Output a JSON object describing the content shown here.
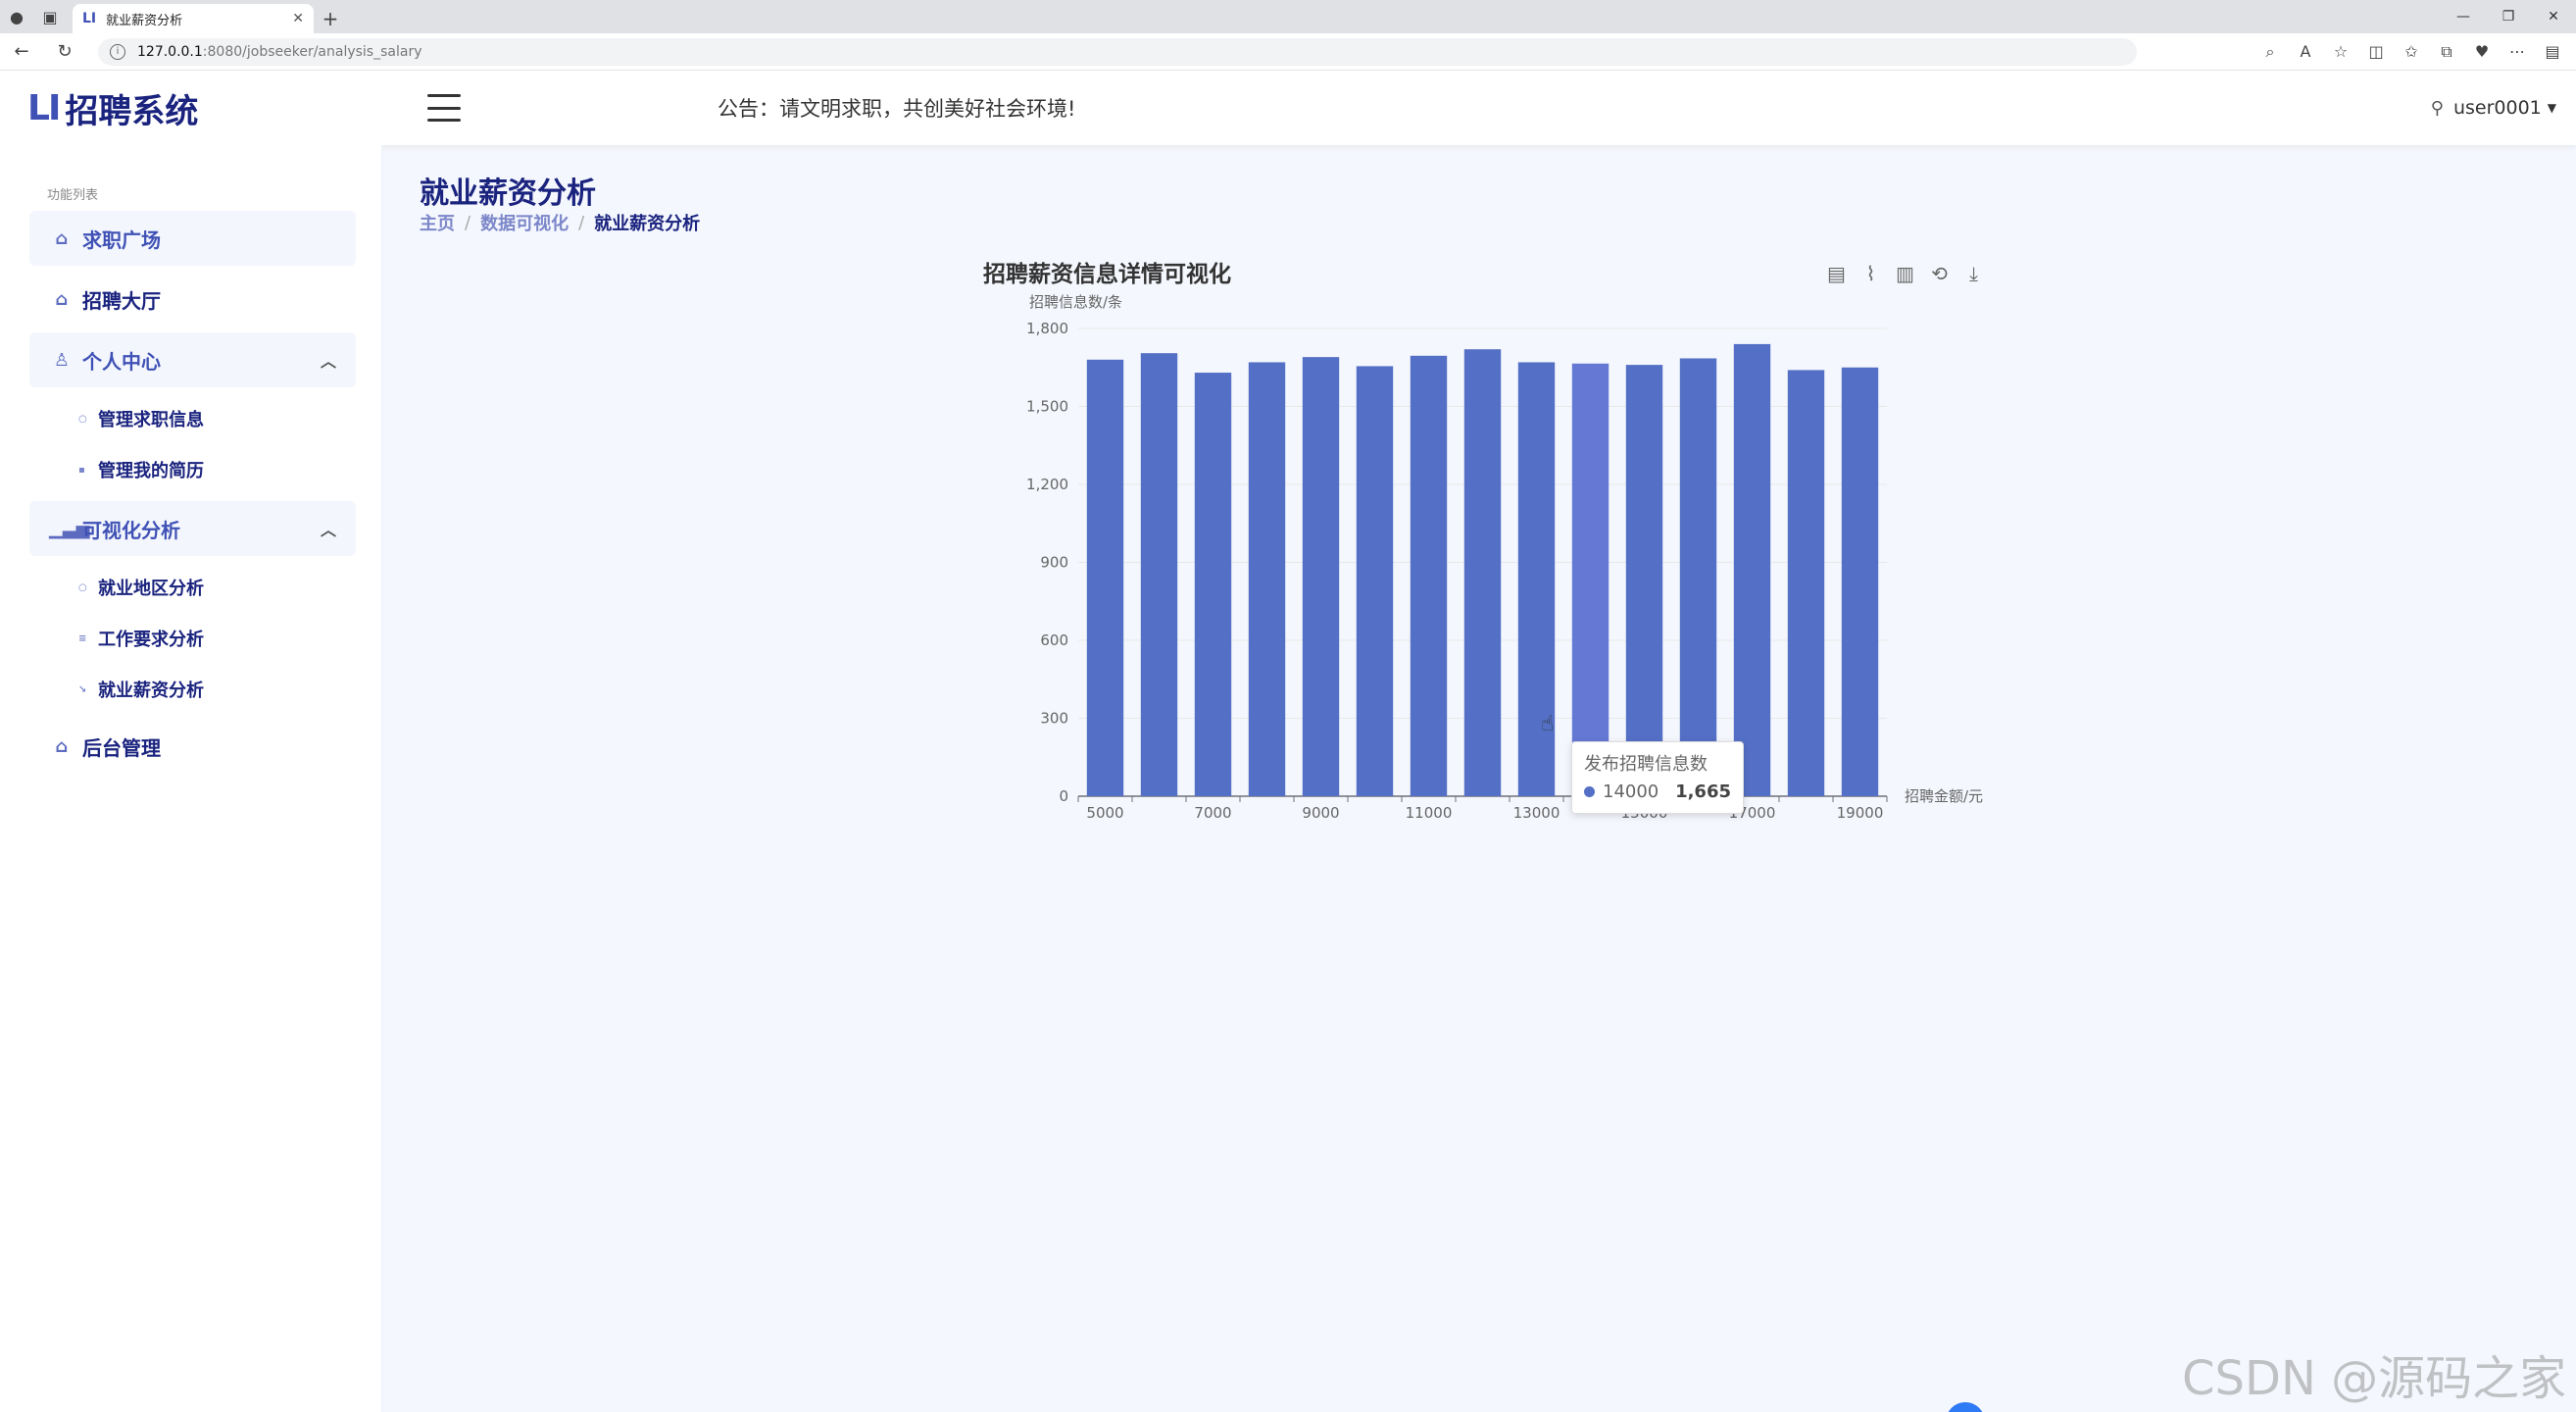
{
  "browser": {
    "tab_title": "就业薪资分析",
    "url_host": "127.0.0.1",
    "url_path": ":8080/jobseeker/analysis_salary"
  },
  "header": {
    "logo_text": "招聘系统",
    "notice": "公告：请文明求职，共创美好社会环境!",
    "username": "user0001"
  },
  "sidebar": {
    "caption": "功能列表",
    "items": [
      {
        "label": "求职广场",
        "icon": "home-icon"
      },
      {
        "label": "招聘大厅",
        "icon": "house-icon"
      },
      {
        "label": "个人中心",
        "icon": "user-icon"
      },
      {
        "label": "管理求职信息",
        "icon": "dot-icon"
      },
      {
        "label": "管理我的简历",
        "icon": "dot-icon"
      },
      {
        "label": "可视化分析",
        "icon": "bar-chart-icon"
      },
      {
        "label": "就业地区分析",
        "icon": "dot-icon"
      },
      {
        "label": "工作要求分析",
        "icon": "dot-icon"
      },
      {
        "label": "就业薪资分析",
        "icon": "dot-icon"
      },
      {
        "label": "后台管理",
        "icon": "house-icon"
      }
    ]
  },
  "main": {
    "title": "就业薪资分析",
    "breadcrumb": [
      "主页",
      "数据可视化",
      "就业薪资分析"
    ]
  },
  "tooltip": {
    "series": "发布招聘信息数",
    "category": "14000",
    "value": "1,665"
  },
  "watermark": "CSDN @源码之家",
  "chart_data": {
    "type": "bar",
    "title": "招聘薪资信息详情可视化",
    "ylabel": "招聘信息数/条",
    "xlabel": "招聘金额/元",
    "ylim": [
      0,
      1800
    ],
    "yticks": [
      0,
      300,
      600,
      900,
      1200,
      1500,
      1800
    ],
    "ytick_labels": [
      "0",
      "300",
      "600",
      "900",
      "1,200",
      "1,500",
      "1,800"
    ],
    "categories": [
      "5000",
      "6000",
      "7000",
      "8000",
      "9000",
      "10000",
      "11000",
      "12000",
      "13000",
      "14000",
      "15000",
      "16000",
      "17000",
      "18000",
      "19000"
    ],
    "shown_tick_labels": [
      "5000",
      "7000",
      "9000",
      "11000",
      "13000",
      "15000",
      "17000",
      "19000"
    ],
    "values": [
      1680,
      1705,
      1630,
      1670,
      1690,
      1655,
      1695,
      1720,
      1670,
      1665,
      1660,
      1685,
      1740,
      1640,
      1650
    ],
    "highlight_index": 9,
    "color": "#5470c6",
    "highlight_color": "#6478d4",
    "grid": true
  }
}
